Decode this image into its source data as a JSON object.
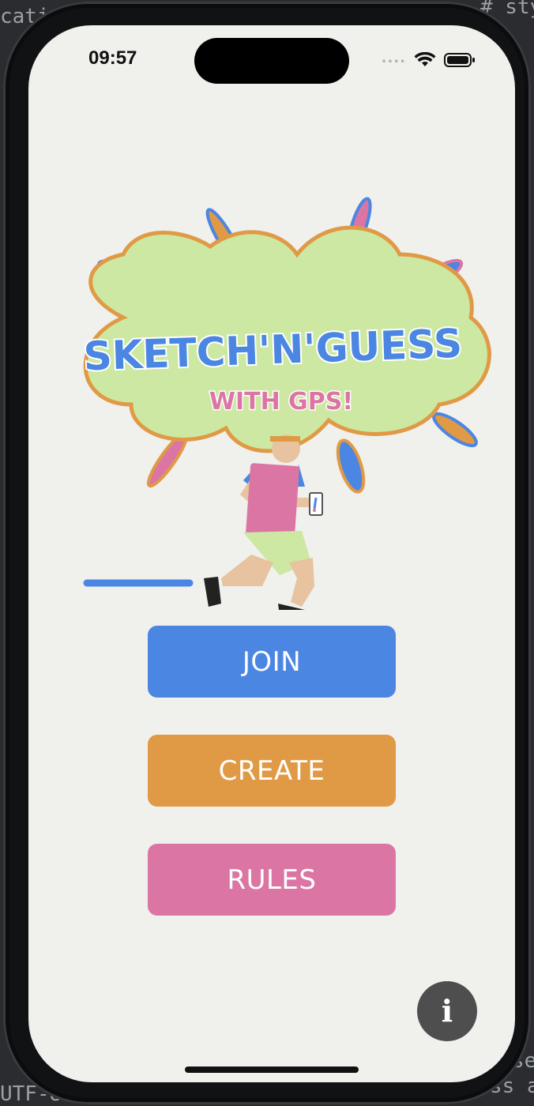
{
  "background_ide": {
    "fragment_top_left": "cati",
    "fragment_top_right": "# sty",
    "fragment_bottom_left": "UTF-8",
    "fragment_bottom_right_1": "se",
    "fragment_bottom_right_2": "ss a"
  },
  "status_bar": {
    "time": "09:57",
    "signal": "....",
    "icons": [
      "wifi-icon",
      "battery-icon"
    ]
  },
  "logo": {
    "title": "SKETCH'N'GUESS",
    "subtitle": "WITH GPS!",
    "colors": {
      "blob": "#cde8a2",
      "blob_outline": "#e09a45",
      "title": "#4b86e3",
      "subtitle": "#db76a4"
    }
  },
  "buttons": {
    "join": "JOIN",
    "create": "CREATE",
    "rules": "RULES"
  },
  "info_button": {
    "icon": "info-icon",
    "glyph": "i"
  },
  "colors": {
    "screen_bg": "#f0f0ed",
    "join": "#4b86e3",
    "create": "#e09a45",
    "rules": "#db76a4",
    "info": "#4e4e4e"
  }
}
